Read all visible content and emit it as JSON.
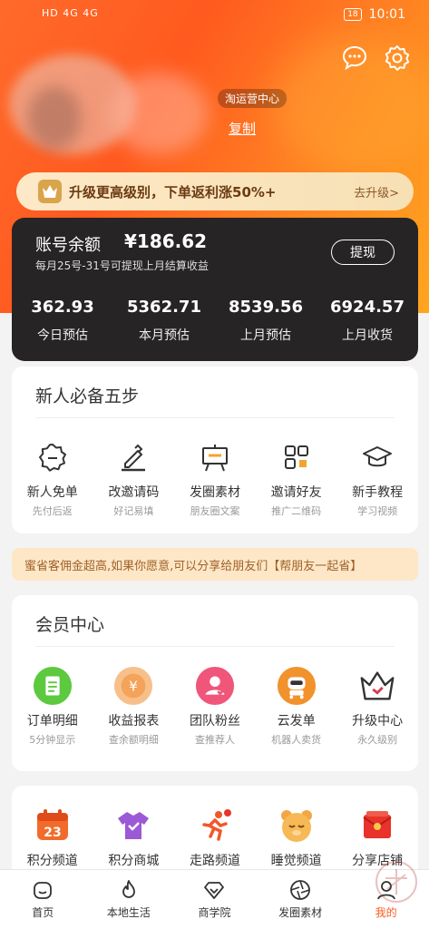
{
  "status_bar": {
    "network": "HD 4G 4G",
    "battery": "18",
    "time": "10:01"
  },
  "header": {
    "center_label": "淘运营中心",
    "copy_link": "复制"
  },
  "upgrade": {
    "text": "升级更高级别，下单返利涨50%+",
    "link": "去升级>"
  },
  "balance": {
    "title": "账号余额",
    "amount": "¥186.62",
    "note": "每月25号-31号可提现上月结算收益",
    "withdraw": "提现",
    "stats": [
      {
        "value": "362.93",
        "label": "今日预估"
      },
      {
        "value": "5362.71",
        "label": "本月预估"
      },
      {
        "value": "8539.56",
        "label": "上月预估"
      },
      {
        "value": "6924.57",
        "label": "上月收货"
      }
    ]
  },
  "steps": {
    "title": "新人必备五步",
    "items": [
      {
        "label": "新人免单",
        "sub": "先付后返",
        "icon": "badge-icon"
      },
      {
        "label": "改邀请码",
        "sub": "好记易填",
        "icon": "pencil-icon"
      },
      {
        "label": "发圈素材",
        "sub": "朋友圈文案",
        "icon": "easel-icon"
      },
      {
        "label": "邀请好友",
        "sub": "推广二维码",
        "icon": "qr-code-icon"
      },
      {
        "label": "新手教程",
        "sub": "学习视频",
        "icon": "graduation-cap-icon"
      }
    ]
  },
  "share_banner": {
    "text": "蜜省客佣金超高,如果你愿意,可以分享给朋友们【帮朋友一起省】"
  },
  "member": {
    "title": "会员中心",
    "items": [
      {
        "label": "订单明细",
        "sub": "5分钟显示",
        "icon": "order-icon",
        "color": "#5cc93e"
      },
      {
        "label": "收益报表",
        "sub": "查余额明细",
        "icon": "yen-icon",
        "color": "#f4a35b"
      },
      {
        "label": "团队粉丝",
        "sub": "查推荐人",
        "icon": "fans-icon",
        "color": "#f0567a"
      },
      {
        "label": "云发单",
        "sub": "机器人卖货",
        "icon": "robot-icon",
        "color": "#f2922c"
      },
      {
        "label": "升级中心",
        "sub": "永久级别",
        "icon": "crown-icon",
        "color": "#d23d59"
      }
    ]
  },
  "channels": {
    "items": [
      {
        "label": "积分频道",
        "icon": "calendar-icon",
        "badge": "23"
      },
      {
        "label": "积分商城",
        "icon": "shirt-icon"
      },
      {
        "label": "走路频道",
        "icon": "runner-icon"
      },
      {
        "label": "睡觉频道",
        "icon": "sleep-bear-icon"
      },
      {
        "label": "分享店铺",
        "icon": "red-envelope-icon"
      }
    ]
  },
  "nav": [
    {
      "label": "首页",
      "icon": "home-icon"
    },
    {
      "label": "本地生活",
      "icon": "flame-icon"
    },
    {
      "label": "商学院",
      "icon": "diamond-icon"
    },
    {
      "label": "发圈素材",
      "icon": "aperture-icon"
    },
    {
      "label": "我的",
      "icon": "user-icon",
      "active": true
    }
  ]
}
